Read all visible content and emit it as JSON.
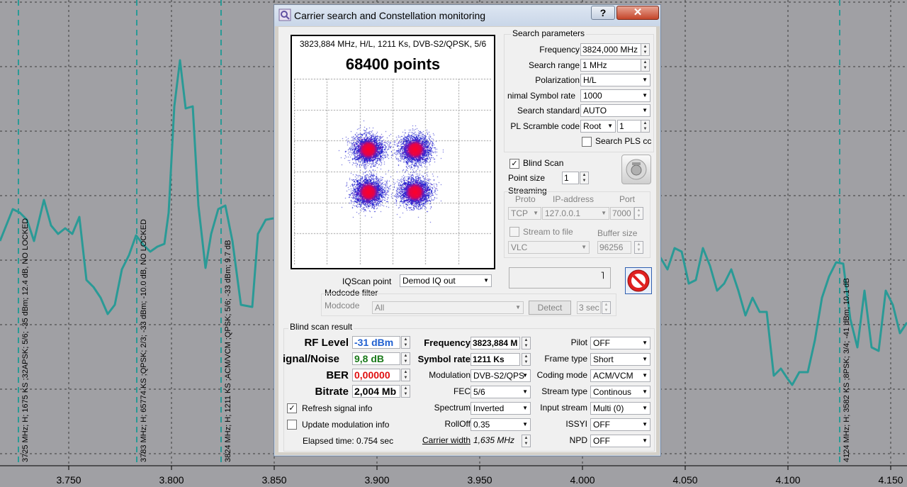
{
  "window": {
    "title": "Carrier search and Constellation monitoring",
    "help_label": "?",
    "close_label": "✕"
  },
  "background_chart": {
    "x_ticks": [
      "3.750",
      "3.800",
      "3.850",
      "3.900",
      "3.950",
      "4.000",
      "4.050",
      "4.100",
      "4.150"
    ],
    "markers": [
      "3725 MHz; H; 1675 KS ;32APSK; 5/6; -35 dBm; 12.4 dB, NO LOCKED",
      "3783 MHz; H; 65774 KS ;QPSK; 2/3; -33 dBm; -10.0 dB, NO LOCKED",
      "3824 MHz; H; 1211 KS ;ACM/VCM ;QPSK; 5/6; -33 dBm; 9.7 dB",
      "4124 MHz; H; 3582 KS ;8PSK; 3/4; -41 dBm; 10.1 dB"
    ],
    "colors": {
      "trace": "#2a9a96",
      "background": "#a0a0a4",
      "grid": "#3a3a3a"
    }
  },
  "constellation": {
    "info": "3823,884 MHz, H/L, 1211 Ks, DVB-S2/QPSK, 5/6",
    "points_label": "68400 points"
  },
  "search_params": {
    "group_title": "Search parameters",
    "frequency_label": "Frequency",
    "frequency_value": "3824,000 MHz",
    "range_label": "Search range",
    "range_value": "1 MHz",
    "polarization_label": "Polarization",
    "polarization_value": "H/L",
    "min_sr_label": "nimal Symbol rate",
    "min_sr_value": "1000",
    "standard_label": "Search standard",
    "standard_value": "AUTO",
    "pls_label": "PL Scramble code",
    "pls_type": "Root",
    "pls_value": "1",
    "search_pls_label": "Search PLS cc"
  },
  "blind_scan_label": "Blind Scan",
  "point_size_label": "Point size",
  "point_size_value": "1",
  "streaming": {
    "title": "Streaming",
    "proto_label": "Proto",
    "proto_value": "TCP",
    "ip_label": "IP-address",
    "ip_value": "127.0.0.1",
    "port_label": "Port",
    "port_value": "7000",
    "stream_file_label": "Stream to file",
    "buffer_label": "Buffer size",
    "player_value": "VLC",
    "buffer_value": "96256"
  },
  "iqscan": {
    "label": "IQScan point",
    "value": "Demod IQ out"
  },
  "modcode": {
    "title": "Modcode filter",
    "label": "Modcode",
    "value": "All",
    "detect_label": "Detect",
    "time_value": "3 sec"
  },
  "result": {
    "title": "Blind scan result",
    "rf_label": "RF Level",
    "rf_value": "-31 dBm",
    "sn_label": "ignal/Noise",
    "sn_value": "9,8 dB",
    "ber_label": "BER",
    "ber_value": "0,00000",
    "bitrate_label": "Bitrate",
    "bitrate_value": "2,004 Mb",
    "refresh_label": "Refresh signal info",
    "update_label": "Update modulation info",
    "elapsed": "Elapsed time: 0.754 sec",
    "freq_label": "Frequency",
    "freq_value": "3823,884 M",
    "sr_label": "Symbol rate",
    "sr_value": "1211 Ks",
    "mod_label": "Modulation",
    "mod_value": "DVB-S2/QPS",
    "fec_label": "FEC",
    "fec_value": "5/6",
    "spectrum_label": "Spectrum",
    "spectrum_value": "Inverted",
    "rolloff_label": "RollOff",
    "rolloff_value": "0.35",
    "cw_label": "Carrier width",
    "cw_value": "1,635 MHz",
    "pilot_label": "Pilot",
    "pilot_value": "OFF",
    "frame_label": "Frame type",
    "frame_value": "Short",
    "coding_label": "Coding mode",
    "coding_value": "ACM/VCM",
    "stype_label": "Stream type",
    "stype_value": "Continous",
    "istream_label": "Input stream",
    "istream_value": "Multi (0)",
    "issyi_label": "ISSYI",
    "issyi_value": "OFF",
    "npd_label": "NPD",
    "npd_value": "OFF"
  }
}
